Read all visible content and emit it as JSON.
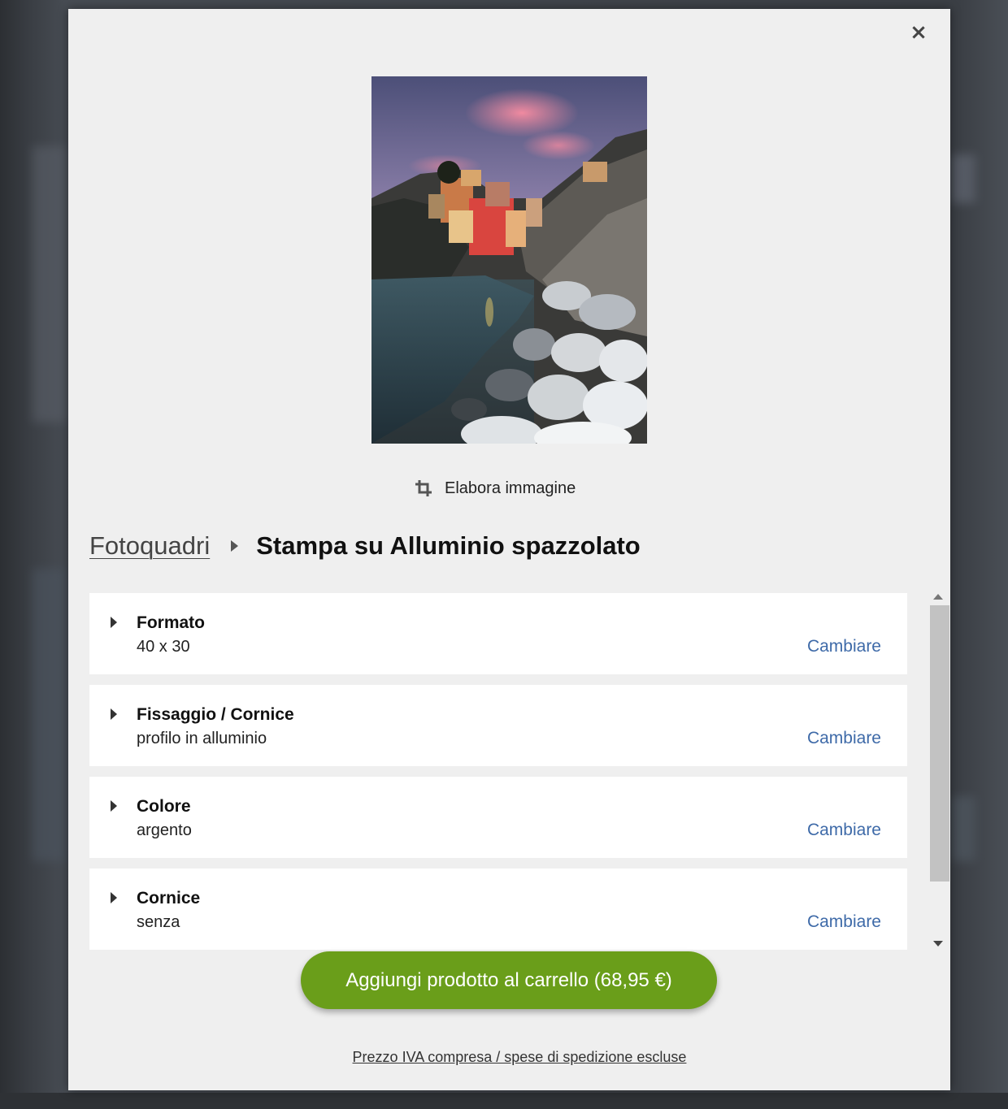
{
  "modal": {
    "close_label": "×"
  },
  "preview": {
    "edit_label": "Elabora immagine"
  },
  "breadcrumb": {
    "parent": "Fotoquadri",
    "current": "Stampa su Alluminio spazzolato"
  },
  "options": [
    {
      "title": "Formato",
      "value": "40 x 30",
      "change_label": "Cambiare"
    },
    {
      "title": "Fissaggio / Cornice",
      "value": "profilo in alluminio",
      "change_label": "Cambiare"
    },
    {
      "title": "Colore",
      "value": "argento",
      "change_label": "Cambiare"
    },
    {
      "title": "Cornice",
      "value": "senza",
      "change_label": "Cambiare"
    }
  ],
  "cart": {
    "button_label": "Aggiungi prodotto al carrello (68,95 €)",
    "price_note": "Prezzo IVA compresa / spese di spedizione escluse"
  },
  "colors": {
    "accent_green": "#6a9e1a",
    "link_blue": "#3e6aa8",
    "modal_bg": "#efefef"
  },
  "icons": {
    "close": "close-icon",
    "crop": "crop-icon",
    "caret": "caret-right-icon"
  }
}
